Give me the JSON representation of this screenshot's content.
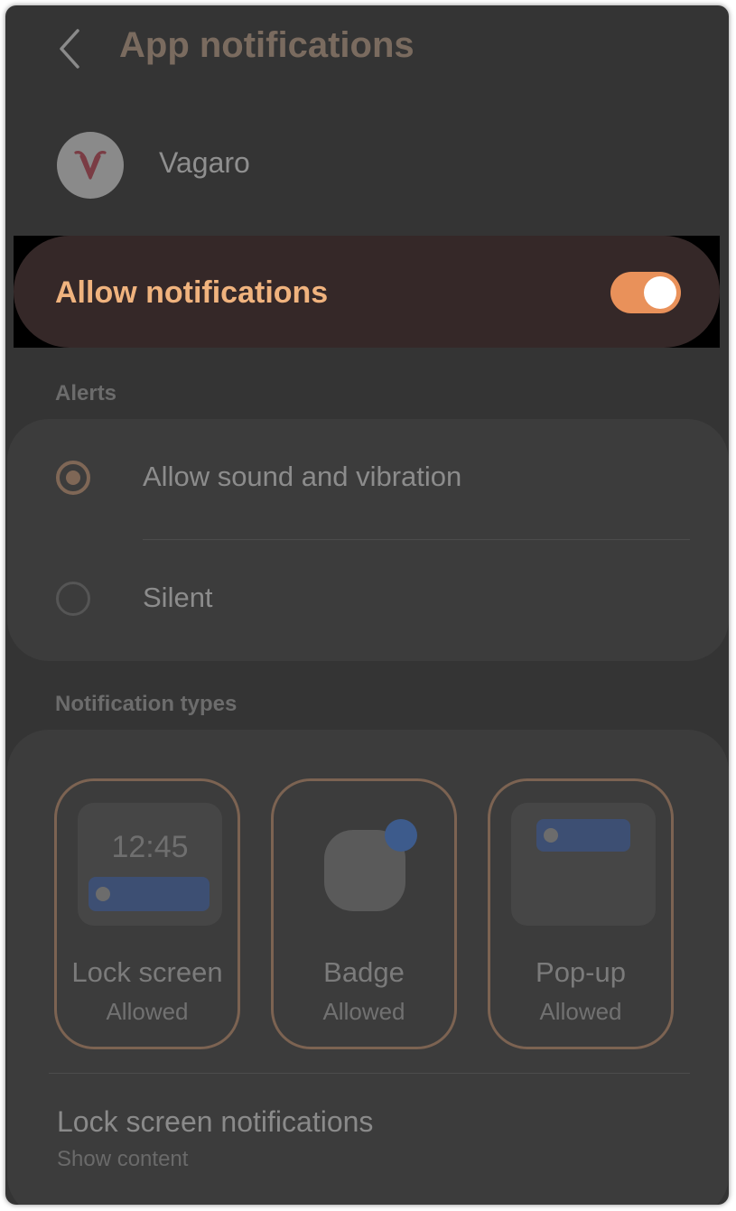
{
  "header": {
    "back_icon": "chevron-left-icon",
    "title": "App notifications"
  },
  "app": {
    "name": "Vagaro",
    "icon": "vagaro-logo-icon"
  },
  "allow_notifications": {
    "label": "Allow notifications",
    "enabled": true,
    "accent_color": "#e9915a",
    "label_color": "#f0b37e"
  },
  "alerts": {
    "section_label": "Alerts",
    "options": [
      {
        "label": "Allow sound and vibration",
        "selected": true
      },
      {
        "label": "Silent",
        "selected": false
      }
    ]
  },
  "notification_types": {
    "section_label": "Notification types",
    "types": [
      {
        "name": "Lock screen",
        "status": "Allowed",
        "preview_time": "12:45"
      },
      {
        "name": "Badge",
        "status": "Allowed"
      },
      {
        "name": "Pop-up",
        "status": "Allowed"
      }
    ]
  },
  "lock_screen_notifications": {
    "title": "Lock screen notifications",
    "subtitle": "Show content"
  }
}
